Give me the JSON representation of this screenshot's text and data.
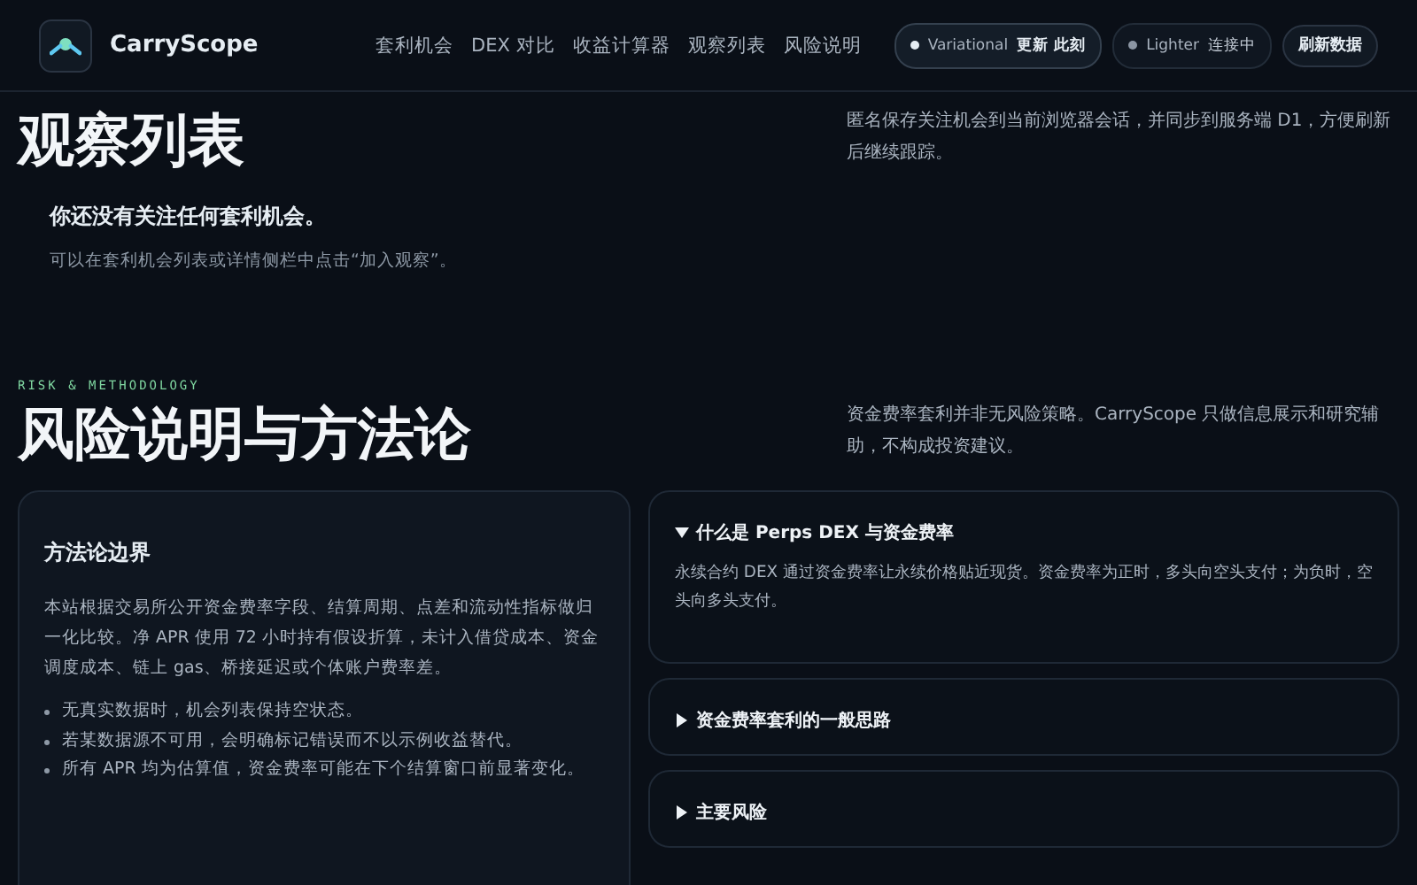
{
  "header": {
    "brand": "CarryScope",
    "nav": [
      {
        "label": "套利机会"
      },
      {
        "label": "DEX 对比"
      },
      {
        "label": "收益计算器"
      },
      {
        "label": "观察列表"
      },
      {
        "label": "风险说明"
      }
    ],
    "sources": [
      {
        "name": "Variational",
        "status": "更新 此刻",
        "active": true,
        "color": "#e6edf3"
      },
      {
        "name": "Lighter",
        "status": "连接中",
        "active": false,
        "color": "#8b95a3"
      }
    ],
    "refresh": "刷新数据"
  },
  "watchlist": {
    "title": "观察列表",
    "description": "匿名保存关注机会到当前浏览器会话，并同步到服务端 D1，方便刷新后继续跟踪。",
    "empty_title": "你还没有关注任何套利机会。",
    "empty_hint": "可以在套利机会列表或详情侧栏中点击“加入观察”。"
  },
  "risk": {
    "eyebrow": "RISK & METHODOLOGY",
    "title": "风险说明与方法论",
    "description": "资金费率套利并非无风险策略。CarryScope 只做信息展示和研究辅助，不构成投资建议。",
    "card": {
      "title": "方法论边界",
      "body": "本站根据交易所公开资金费率字段、结算周期、点差和流动性指标做归一化比较。净 APR 使用 72 小时持有假设折算，未计入借贷成本、资金调度成本、链上 gas、桥接延迟或个体账户费率差。",
      "bullets": [
        "无真实数据时，机会列表保持空状态。",
        "若某数据源不可用，会明确标记错误而不以示例收益替代。",
        "所有 APR 均为估算值，资金费率可能在下个结算窗口前显著变化。"
      ]
    },
    "faq": [
      {
        "title": "什么是 Perps DEX 与资金费率",
        "expanded": true,
        "body": "永续合约 DEX 通过资金费率让永续价格贴近现货。资金费率为正时，多头向空头支付；为负时，空头向多头支付。"
      },
      {
        "title": "资金费率套利的一般思路",
        "expanded": false
      },
      {
        "title": "主要风险",
        "expanded": false
      }
    ]
  }
}
